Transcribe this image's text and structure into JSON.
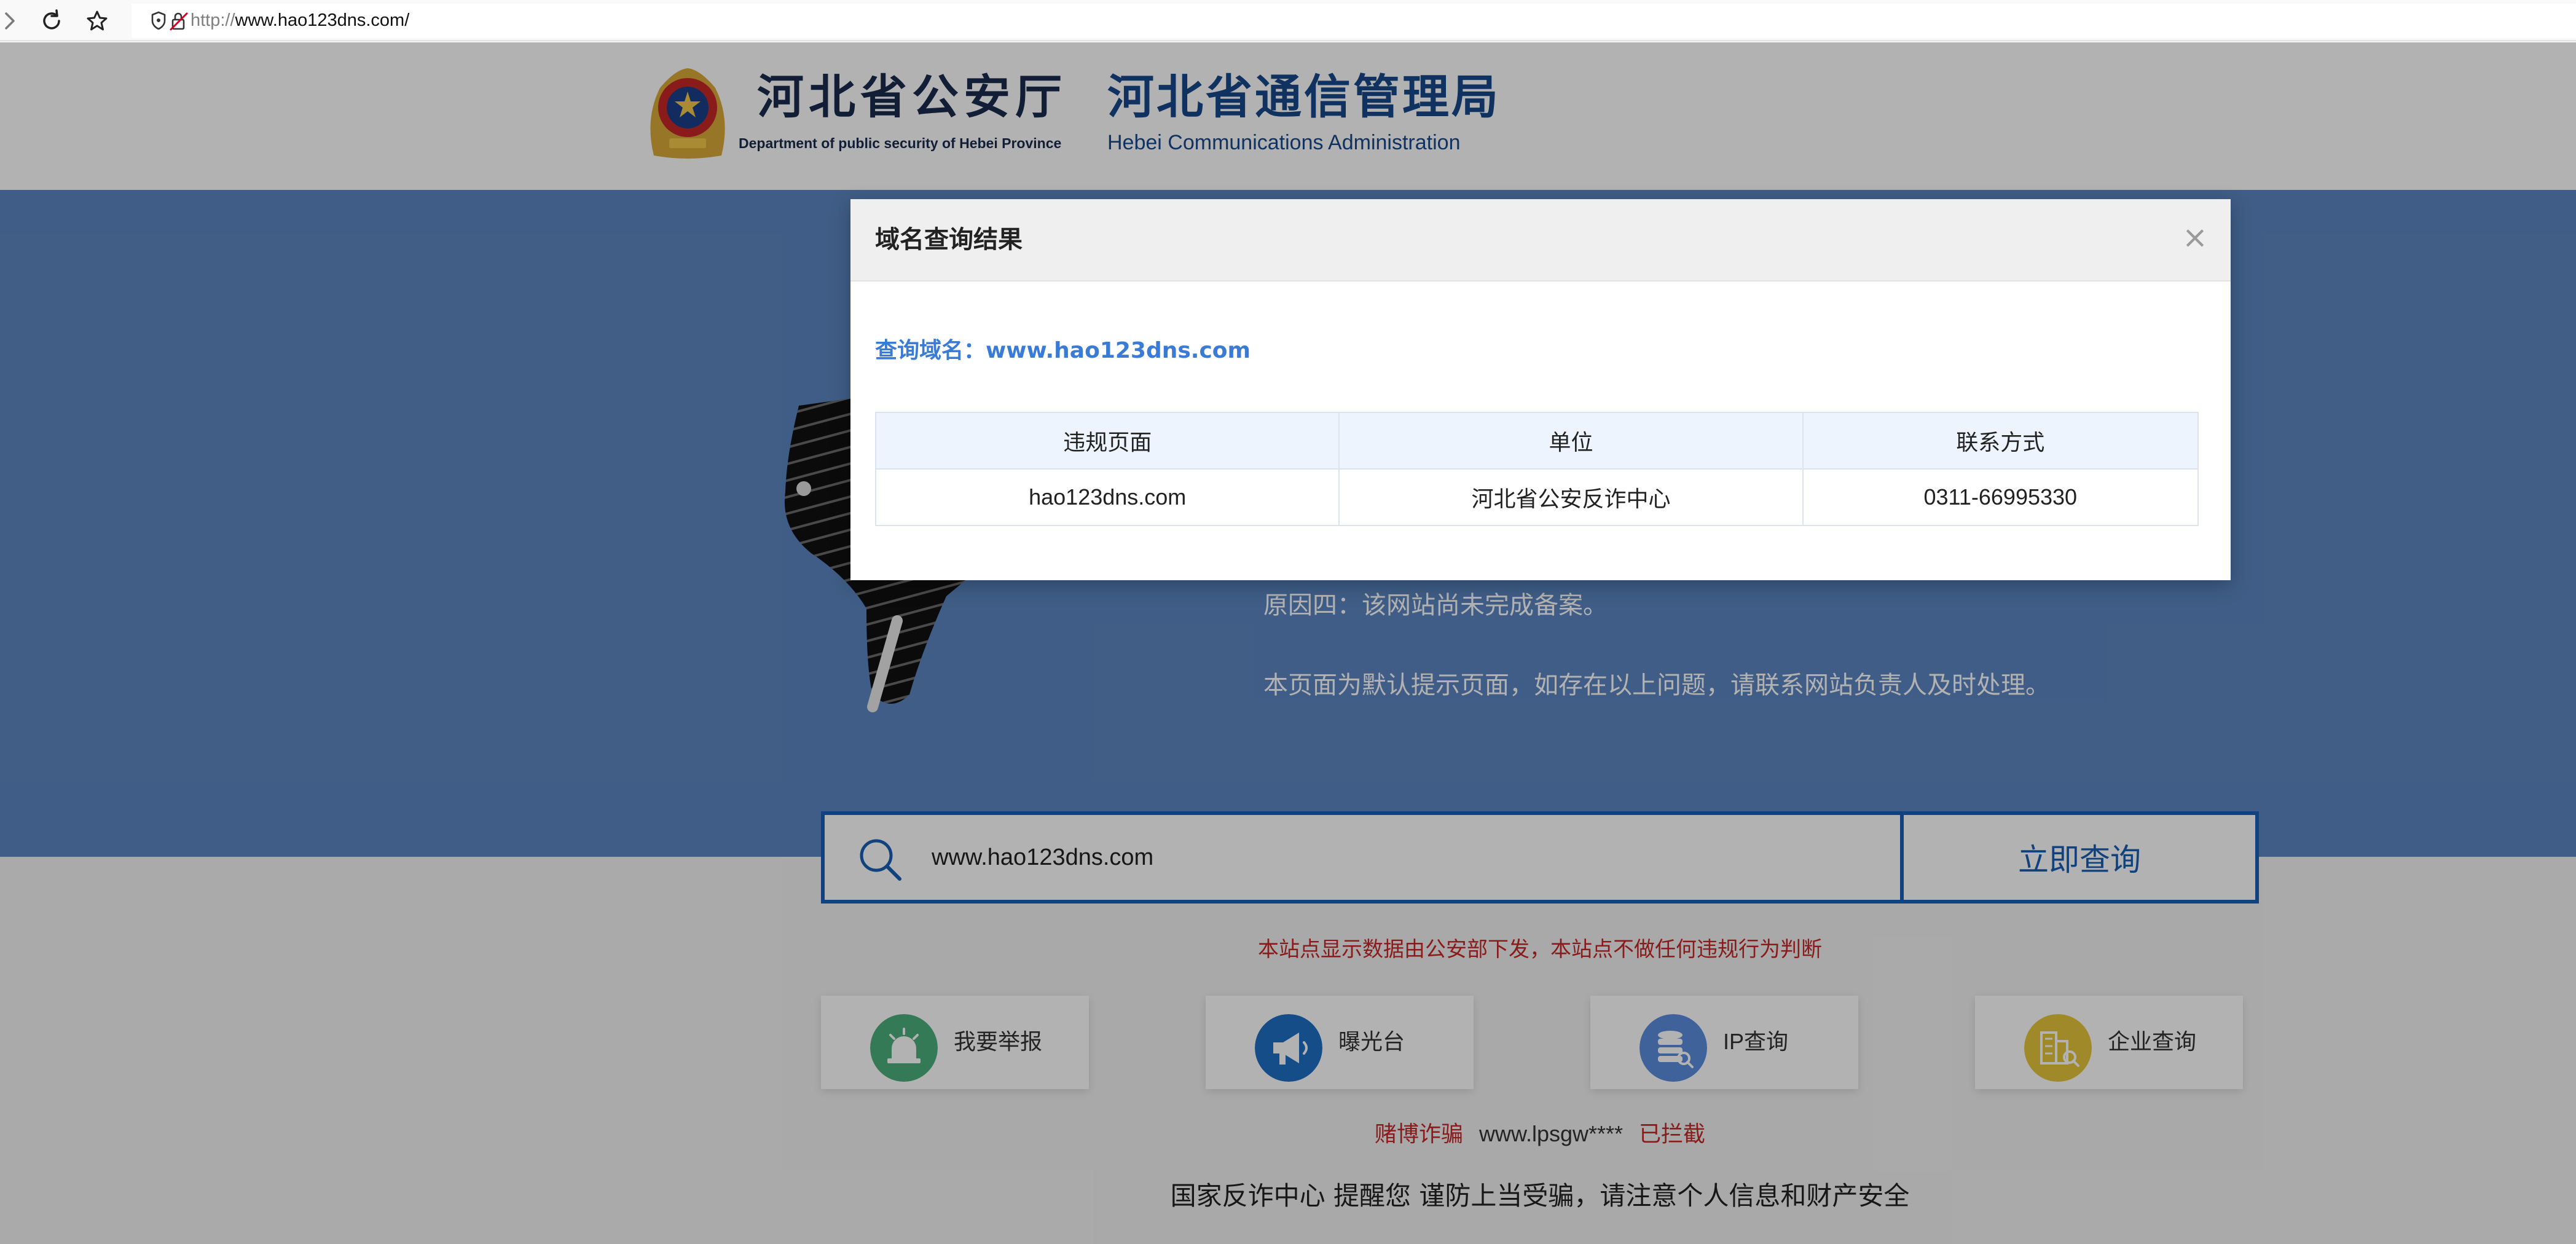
{
  "browser": {
    "url_scheme": "http://",
    "url_host": "www.hao123dns.com/",
    "icons": [
      "forward-icon",
      "reload-icon",
      "star-icon",
      "shield-icon",
      "insecure-lock-icon"
    ]
  },
  "header": {
    "org1": {
      "title": "河北省公安厅",
      "subtitle": "Department of public security of Hebei Province"
    },
    "org2": {
      "title": "河北省通信管理局",
      "subtitle": "Hebei Communications Administration"
    },
    "emblem_icon": "police-emblem-icon"
  },
  "main": {
    "reason4": "原因四：该网站尚未完成备案。",
    "notice": "本页面为默认提示页面，如存在以上问题，请联系网站负责人及时处理。",
    "illustration_icon": "stop-hand-icon"
  },
  "search": {
    "value": "www.hao123dns.com",
    "button_label": "立即查询",
    "icon": "search-icon"
  },
  "disclaimer": "本站点显示数据由公安部下发，本站点不做任何违规行为判断",
  "cards": [
    {
      "label": "我要举报",
      "icon": "alarm-siren-icon",
      "color": "#4caf7d"
    },
    {
      "label": "曝光台",
      "icon": "megaphone-icon",
      "color": "#1f6fc5"
    },
    {
      "label": "IP查询",
      "icon": "database-search-icon",
      "color": "#5b8dde"
    },
    {
      "label": "企业查询",
      "icon": "building-search-icon",
      "color": "#e6c43c"
    }
  ],
  "ticker": {
    "tag": "赌博诈骗",
    "site": "www.lpsgw****",
    "status": "已拦截"
  },
  "bottom_warning": "国家反诈中心 提醒您 谨防上当受骗，请注意个人信息和财产安全",
  "modal": {
    "title": "域名查询结果",
    "close_label": "×",
    "query_label": "查询域名：",
    "query_domain": "www.hao123dns.com",
    "table": {
      "headers": [
        "违规页面",
        "单位",
        "联系方式"
      ],
      "rows": [
        [
          "hao123dns.com",
          "河北省公安反诈中心",
          "0311-66995330"
        ]
      ]
    }
  },
  "colors": {
    "brand_blue": "#1a5fb4",
    "band_blue": "#5b86c0",
    "alert_red": "#c62828",
    "link_blue": "#3a7bd5"
  }
}
